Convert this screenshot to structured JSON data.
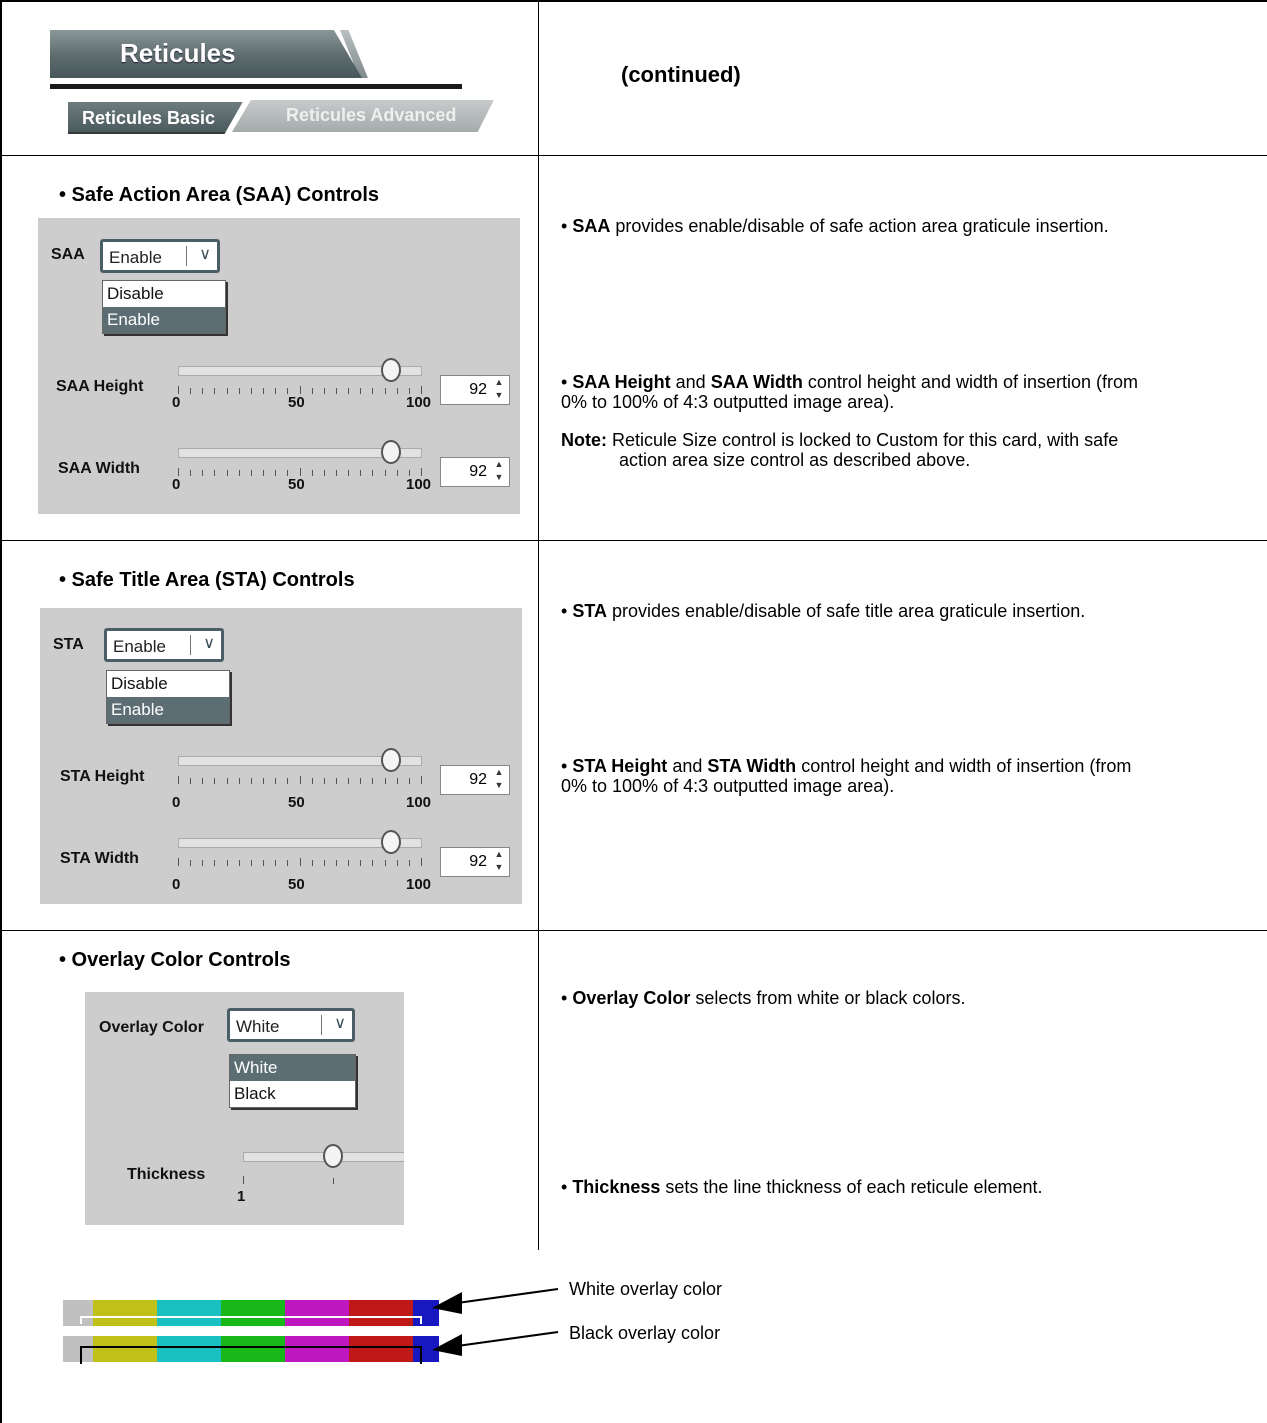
{
  "header": {
    "tab_title": "Reticules",
    "tab_basic": "Reticules Basic",
    "tab_advanced": "Reticules Advanced",
    "continued": "(continued)"
  },
  "saa": {
    "section_title": "• Safe Action Area (SAA) Controls",
    "label": "SAA",
    "combo_value": "Enable",
    "options": [
      "Disable",
      "Enable"
    ],
    "selected_option": "Enable",
    "height_label": "SAA Height",
    "width_label": "SAA Width",
    "height_value": "92",
    "width_value": "92",
    "height_level": 92,
    "width_level": 92,
    "scale": [
      "0",
      "50",
      "100"
    ],
    "desc1_bold": "SAA",
    "desc1_rest": " provides enable/disable of safe action area graticule insertion.",
    "desc2_bold1": "SAA Height",
    "desc2_mid": " and ",
    "desc2_bold2": "SAA Width",
    "desc2_rest": " control height and width of insertion (from",
    "desc2_line2": "0% to 100% of 4:3 outputted image area).",
    "note_label": "Note:",
    "note_line1": " Reticule Size control is locked to Custom for this card, with safe",
    "note_line2": "action area size control as described above."
  },
  "sta": {
    "section_title": "• Safe Title Area (STA) Controls",
    "label": "STA",
    "combo_value": "Enable",
    "options": [
      "Disable",
      "Enable"
    ],
    "selected_option": "Enable",
    "height_label": "STA Height",
    "width_label": "STA Width",
    "height_value": "92",
    "width_value": "92",
    "height_level": 92,
    "width_level": 92,
    "scale": [
      "0",
      "50",
      "100"
    ],
    "desc1_bold": "STA",
    "desc1_rest": " provides enable/disable of safe title area graticule insertion.",
    "desc2_bold1": "STA Height",
    "desc2_mid": " and ",
    "desc2_bold2": "STA Width",
    "desc2_rest": " control height and width of insertion (from",
    "desc2_line2": "0% to 100% of 4:3 outputted image area)."
  },
  "overlay": {
    "section_title": "• Overlay Color Controls",
    "color_label": "Overlay Color",
    "combo_value": "White",
    "options": [
      "White",
      "Black"
    ],
    "selected_option": "White",
    "thickness_label": "Thickness",
    "thickness_min": "1",
    "desc1_bold": "Overlay Color",
    "desc1_rest": " selects from white or black colors.",
    "desc2_bold": "Thickness",
    "desc2_rest": " sets the line thickness of each reticule element.",
    "caption_white": "White overlay color",
    "caption_black": "Black overlay color",
    "bar_colors": [
      "#c0c0c0",
      "#c0c018",
      "#18c0c0",
      "#18b818",
      "#c018c0",
      "#c01818",
      "#1818c0"
    ]
  }
}
